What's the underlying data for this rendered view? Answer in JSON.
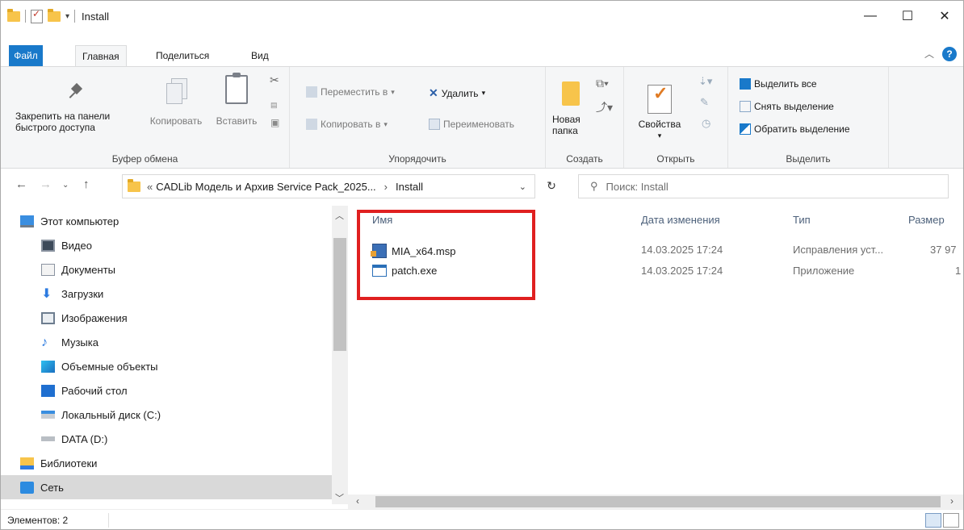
{
  "window": {
    "title": "Install"
  },
  "window_controls": {
    "minimize": "—",
    "maximize": "☐",
    "close": "✕"
  },
  "tabs": [
    {
      "label": "Файл"
    },
    {
      "label": "Главная"
    },
    {
      "label": "Поделиться"
    },
    {
      "label": "Вид"
    }
  ],
  "ribbon": {
    "clipboard": {
      "pin_label_1": "Закрепить на панели",
      "pin_label_2": "быстрого доступа",
      "copy": "Копировать",
      "paste": "Вставить",
      "group": "Буфер обмена"
    },
    "organize": {
      "move_to": "Переместить в",
      "copy_to": "Копировать в",
      "delete": "Удалить",
      "rename": "Переименовать",
      "group": "Упорядочить"
    },
    "new": {
      "folder_1": "Новая",
      "folder_2": "папка",
      "group": "Создать"
    },
    "open": {
      "properties": "Свойства",
      "group": "Открыть"
    },
    "select": {
      "select_all": "Выделить все",
      "select_none": "Снять выделение",
      "invert": "Обратить выделение",
      "group": "Выделить"
    }
  },
  "address": {
    "path_parent": "CADLib Модель и Архив Service Pack_2025...",
    "path_current": "Install",
    "search_placeholder": "Поиск: Install"
  },
  "nav": [
    {
      "label": "Этот компьютер"
    },
    {
      "label": "Видео"
    },
    {
      "label": "Документы"
    },
    {
      "label": "Загрузки"
    },
    {
      "label": "Изображения"
    },
    {
      "label": "Музыка"
    },
    {
      "label": "Объемные объекты"
    },
    {
      "label": "Рабочий стол"
    },
    {
      "label": "Локальный диск (C:)"
    },
    {
      "label": "DATA (D:)"
    },
    {
      "label": "Библиотеки"
    },
    {
      "label": "Сеть"
    }
  ],
  "columns": {
    "name": "Имя",
    "date": "Дата изменения",
    "type": "Тип",
    "size": "Размер"
  },
  "files": [
    {
      "name": "MIA_x64.msp",
      "date": "14.03.2025 17:24",
      "type": "Исправления уст...",
      "size": "37 97"
    },
    {
      "name": "patch.exe",
      "date": "14.03.2025 17:24",
      "type": "Приложение",
      "size": "1"
    }
  ],
  "status": {
    "items": "Элементов: 2"
  },
  "colors": {
    "accent": "#1979ca",
    "highlight_box": "#e02020",
    "folder": "#f7c44b"
  },
  "icons": {
    "pin": "pin-icon",
    "copy": "copy-icon",
    "paste": "paste-icon",
    "cut": "scissors-icon",
    "delete": "x-icon",
    "folder": "folder-icon",
    "properties": "check-document-icon",
    "refresh": "refresh-icon",
    "search": "search-icon"
  }
}
